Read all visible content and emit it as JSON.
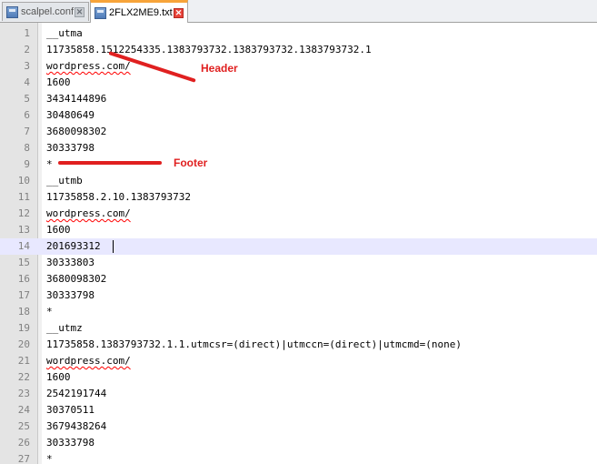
{
  "tabs": [
    {
      "label": "scalpel.conf",
      "active": false
    },
    {
      "label": "2FLX2ME9.txt",
      "active": true
    }
  ],
  "editor": {
    "current_line": 14,
    "lines": [
      {
        "n": "1",
        "text": "__utma"
      },
      {
        "n": "2",
        "text": "11735858.1512254335.1383793732.1383793732.1383793732.1"
      },
      {
        "n": "3",
        "text": "wordpress.com/"
      },
      {
        "n": "4",
        "text": "1600"
      },
      {
        "n": "5",
        "text": "3434144896"
      },
      {
        "n": "6",
        "text": "30480649"
      },
      {
        "n": "7",
        "text": "3680098302"
      },
      {
        "n": "8",
        "text": "30333798"
      },
      {
        "n": "9",
        "text": "*"
      },
      {
        "n": "10",
        "text": "__utmb"
      },
      {
        "n": "11",
        "text": "11735858.2.10.1383793732"
      },
      {
        "n": "12",
        "text": "wordpress.com/"
      },
      {
        "n": "13",
        "text": "1600"
      },
      {
        "n": "14",
        "text": "201693312"
      },
      {
        "n": "15",
        "text": "30333803"
      },
      {
        "n": "16",
        "text": "3680098302"
      },
      {
        "n": "17",
        "text": "30333798"
      },
      {
        "n": "18",
        "text": "*"
      },
      {
        "n": "19",
        "text": "__utmz"
      },
      {
        "n": "20",
        "text": "11735858.1383793732.1.1.utmcsr=(direct)|utmccn=(direct)|utmcmd=(none)"
      },
      {
        "n": "21",
        "text": "wordpress.com/"
      },
      {
        "n": "22",
        "text": "1600"
      },
      {
        "n": "23",
        "text": "2542191744"
      },
      {
        "n": "24",
        "text": "30370511"
      },
      {
        "n": "25",
        "text": "3679438264"
      },
      {
        "n": "26",
        "text": "30333798"
      },
      {
        "n": "27",
        "text": "*"
      }
    ]
  },
  "annotations": {
    "header_label": "Header",
    "footer_label": "Footer",
    "color": "#e02020"
  },
  "icons": {
    "tab_file": "floppy-disk-icon",
    "tab_close": "close-icon"
  }
}
